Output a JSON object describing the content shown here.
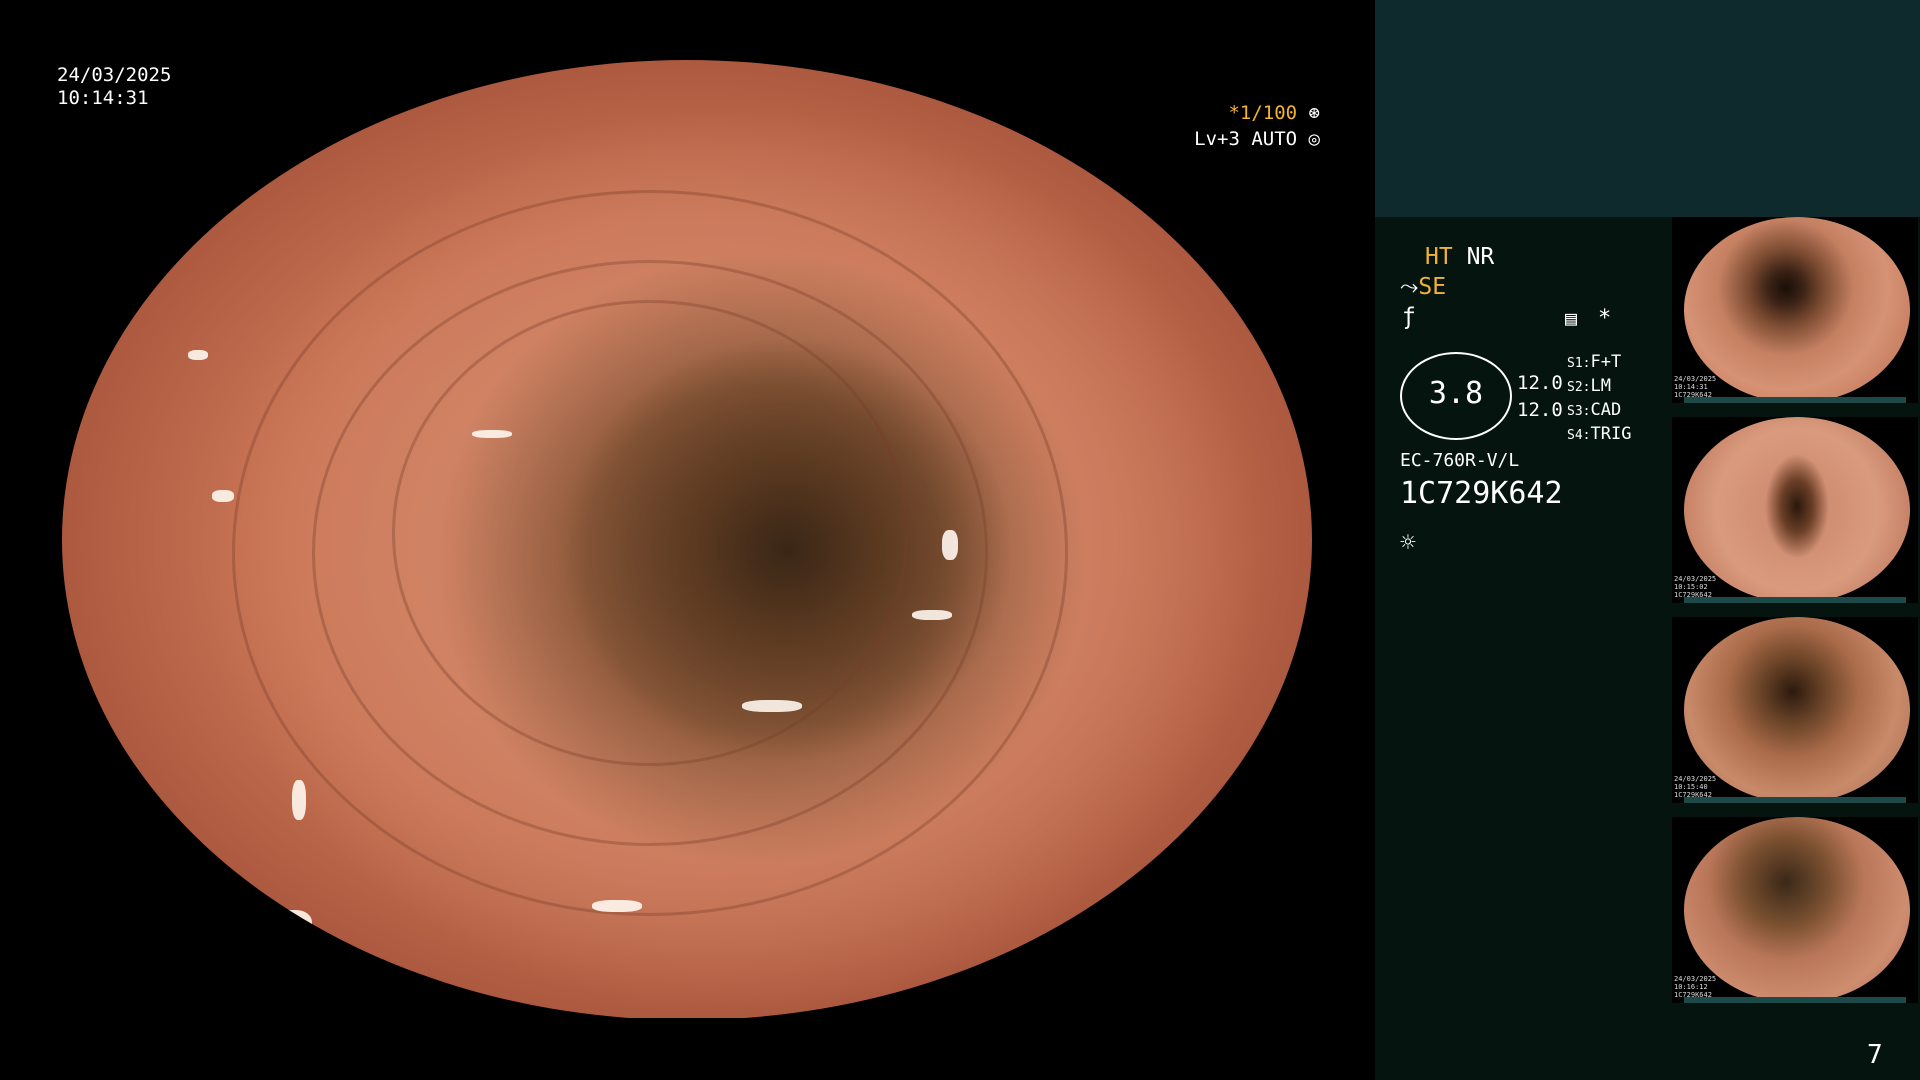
{
  "overlay": {
    "date": "24/03/2025",
    "time": "10:14:31",
    "shutter": "*1/100",
    "level": "Lv+3 AUTO"
  },
  "info": {
    "ht": "HT",
    "nr": "NR",
    "se": "SE",
    "f_symbol": "ƒ",
    "gauge_value": "3.8",
    "val1": "12.0",
    "val2": "12.0",
    "s1_key": "S1:",
    "s1_val": "F+T",
    "s2_key": "S2:",
    "s2_val": "LM",
    "s3_key": "S3:",
    "s3_val": "CAD",
    "s4_key": "S4:",
    "s4_val": "TRIG",
    "scope_model": "EC-760R-V/L",
    "serial": "1C729K642",
    "star": "*"
  },
  "thumbnails": [
    {
      "label": "24/03/2025\n10:14:31\n1C729K642"
    },
    {
      "label": "24/03/2025\n10:15:02\n1C729K642"
    },
    {
      "label": "24/03/2025\n10:15:40\n1C729K642"
    },
    {
      "label": "24/03/2025\n10:16:12\n1C729K642"
    }
  ],
  "page_number": "7",
  "colors": {
    "accent": "#f2b233",
    "panel_top": "#0e2a2c",
    "panel": "#06140f"
  },
  "icons": [
    "shutter-icon",
    "auto-iris-icon",
    "scope-curve-icon",
    "settings-list-icon",
    "light-icon"
  ]
}
